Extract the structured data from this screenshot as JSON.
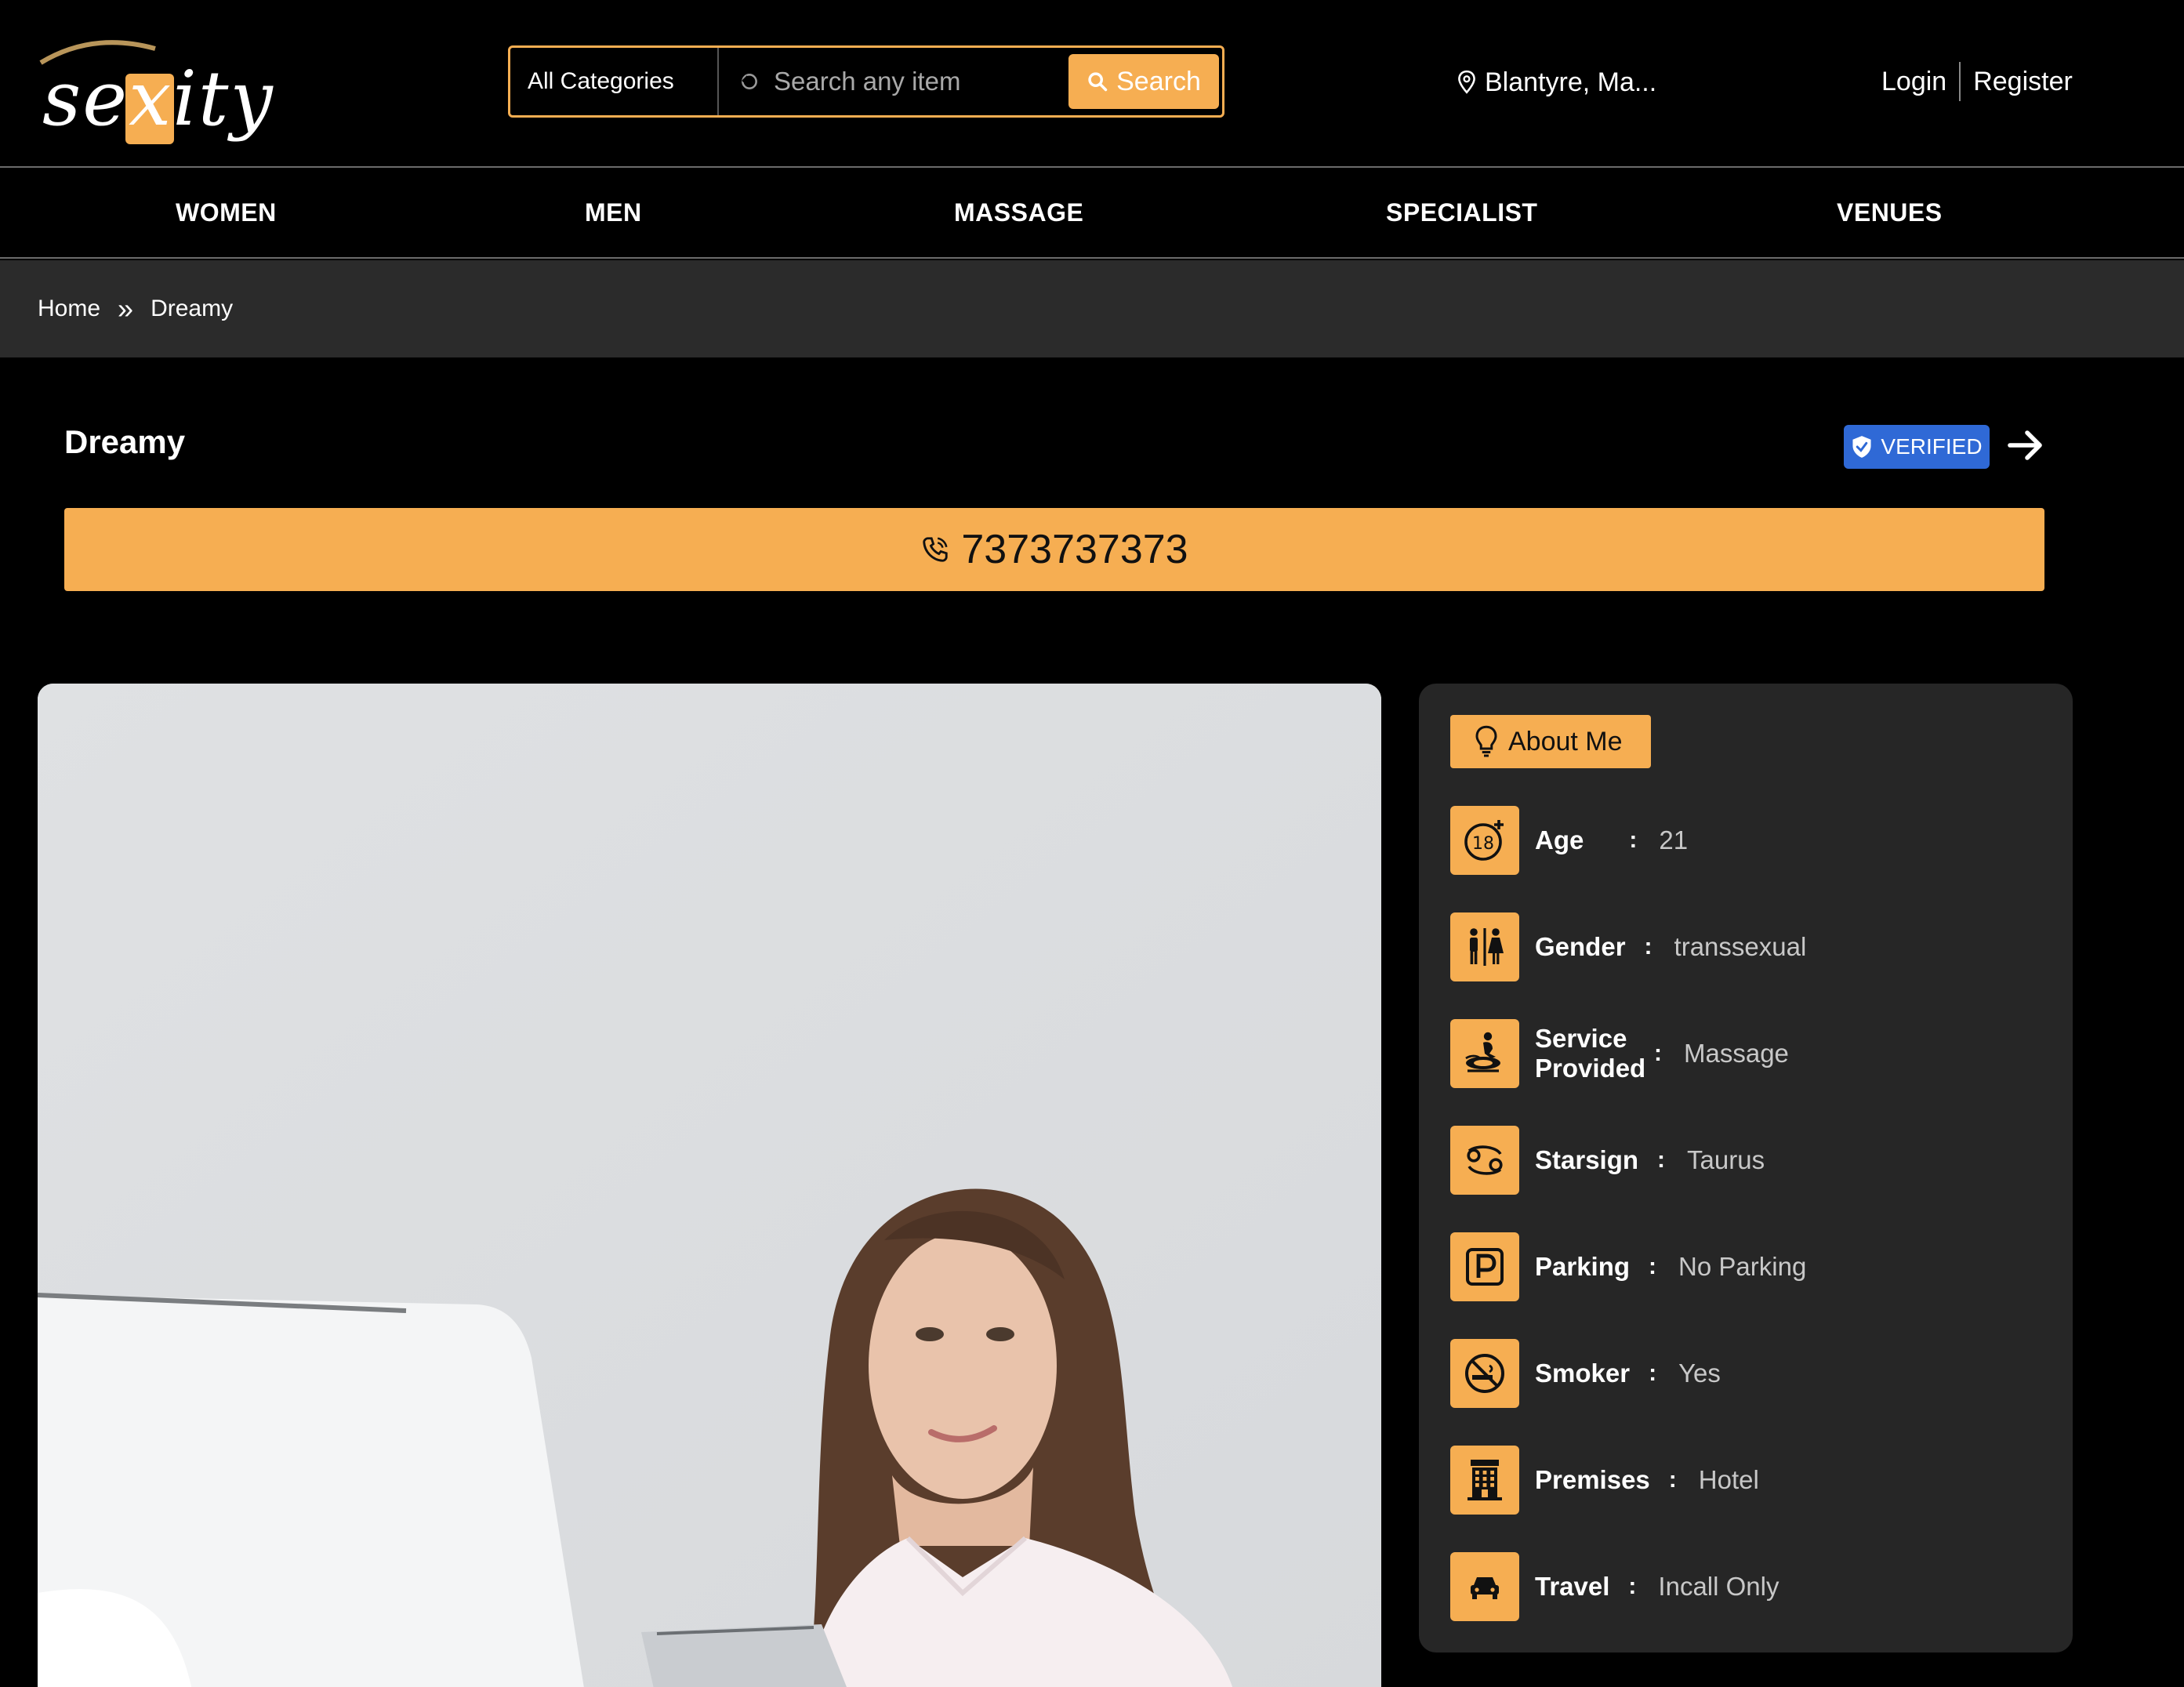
{
  "header": {
    "logo_text": "sexity",
    "category_select": "All Categories",
    "search_placeholder": "Search any item",
    "search_button": "Search",
    "location": "Blantyre, Ma...",
    "login": "Login",
    "register": "Register"
  },
  "nav": {
    "items": [
      "WOMEN",
      "MEN",
      "MASSAGE",
      "SPECIALIST",
      "VENUES"
    ]
  },
  "breadcrumb": {
    "home": "Home",
    "separator": "»",
    "current": "Dreamy"
  },
  "profile": {
    "name": "Dreamy",
    "verified_label": "VERIFIED",
    "phone": "7373737373"
  },
  "about": {
    "heading": "About Me",
    "rows": [
      {
        "label": "Age",
        "value": "21",
        "icon": "age-18-icon"
      },
      {
        "label": "Gender",
        "value": "transsexual",
        "icon": "gender-icon"
      },
      {
        "label": "Service Provided",
        "value": "Massage",
        "icon": "massage-icon"
      },
      {
        "label": "Starsign",
        "value": "Taurus",
        "icon": "starsign-icon"
      },
      {
        "label": "Parking",
        "value": "No Parking",
        "icon": "parking-icon"
      },
      {
        "label": "Smoker",
        "value": "Yes",
        "icon": "no-smoking-icon"
      },
      {
        "label": "Premises",
        "value": "Hotel",
        "icon": "hotel-icon"
      },
      {
        "label": "Travel",
        "value": "Incall Only",
        "icon": "car-icon"
      }
    ]
  },
  "colors": {
    "accent": "#f6ae52",
    "verified": "#2f69d6",
    "panel": "#262626",
    "breadcrumb_bg": "#2b2b2b"
  }
}
